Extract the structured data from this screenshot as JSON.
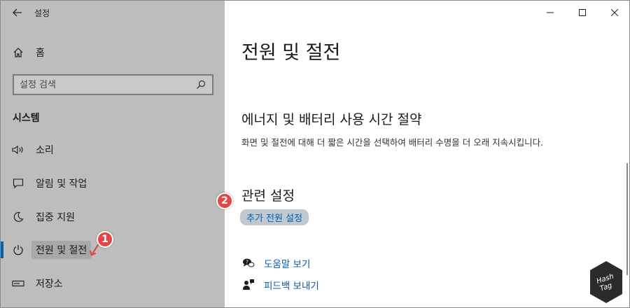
{
  "window": {
    "title": "설정"
  },
  "sidebar": {
    "home_label": "홈",
    "search_placeholder": "설정 검색",
    "section_title": "시스템",
    "items": [
      {
        "label": "소리",
        "icon": "speaker-icon"
      },
      {
        "label": "알림 및 작업",
        "icon": "notification-icon"
      },
      {
        "label": "집중 지원",
        "icon": "moon-icon"
      },
      {
        "label": "전원 및 절전",
        "icon": "power-icon",
        "active": true
      },
      {
        "label": "저장소",
        "icon": "storage-icon"
      }
    ]
  },
  "main": {
    "page_title": "전원 및 절전",
    "energy_title": "에너지 및 배터리 사용 시간 절약",
    "energy_desc": "화면 및 절전에 대해 더 짧은 시간을 선택하여 배터리 수명을 더 오래 지속시킵니다.",
    "related_title": "관련 설정",
    "related_link": "추가 전원 설정",
    "help_label": "도움말 보기",
    "feedback_label": "피드백 보내기"
  },
  "annotations": {
    "badge_1": "1",
    "badge_2": "2"
  },
  "watermark": {
    "line1": "Hash",
    "line2": "Tag"
  },
  "colors": {
    "accent": "#0063b1",
    "link": "#0a5aa8",
    "badge": "#e04848",
    "sidebar_bg": "#bdbdbd"
  }
}
